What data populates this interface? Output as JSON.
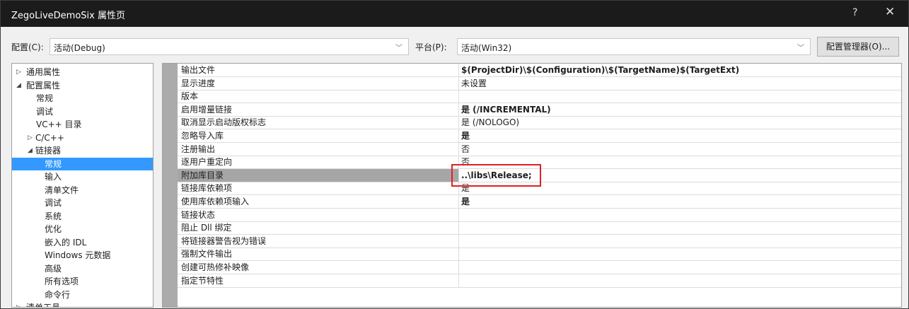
{
  "window": {
    "title": "ZegoLiveDemoSix 属性页",
    "help": "?",
    "close": "✕"
  },
  "config": {
    "config_label": "配置(C):",
    "config_value": "活动(Debug)",
    "platform_label": "平台(P):",
    "platform_value": "活动(Win32)",
    "manager_button": "配置管理器(O)..."
  },
  "tree": {
    "items": [
      {
        "label": "通用属性",
        "arrow": "▷"
      },
      {
        "label": "配置属性",
        "arrow": "◢"
      },
      {
        "label": "常规"
      },
      {
        "label": "调试"
      },
      {
        "label": "VC++ 目录"
      },
      {
        "label": "C/C++",
        "arrow": "▷"
      },
      {
        "label": "链接器",
        "arrow": "◢"
      },
      {
        "label": "常规",
        "selected": true
      },
      {
        "label": "输入"
      },
      {
        "label": "清单文件"
      },
      {
        "label": "调试"
      },
      {
        "label": "系统"
      },
      {
        "label": "优化"
      },
      {
        "label": "嵌入的 IDL"
      },
      {
        "label": "Windows 元数据"
      },
      {
        "label": "高级"
      },
      {
        "label": "所有选项"
      },
      {
        "label": "命令行"
      },
      {
        "label": "清单工具",
        "arrow": "▷"
      }
    ]
  },
  "grid": {
    "rows": [
      {
        "name": "输出文件",
        "value": "$(ProjectDir)\\$(Configuration)\\$(TargetName)$(TargetExt)",
        "bold": true
      },
      {
        "name": "显示进度",
        "value": "未设置"
      },
      {
        "name": "版本",
        "value": ""
      },
      {
        "name": "启用增量链接",
        "value": "是 (/INCREMENTAL)",
        "bold": true
      },
      {
        "name": "取消显示启动版权标志",
        "value": "是 (/NOLOGO)"
      },
      {
        "name": "忽略导入库",
        "value": "是",
        "bold": true
      },
      {
        "name": "注册输出",
        "value": "否"
      },
      {
        "name": "逐用户重定向",
        "value": "否"
      },
      {
        "name": "附加库目录",
        "value": "..\\libs\\Release;",
        "bold": true,
        "selected": true
      },
      {
        "name": "链接库依赖项",
        "value": "是"
      },
      {
        "name": "使用库依赖项输入",
        "value": "是",
        "bold": true
      },
      {
        "name": "链接状态",
        "value": ""
      },
      {
        "name": "阻止 Dll 绑定",
        "value": ""
      },
      {
        "name": "将链接器警告视为错误",
        "value": ""
      },
      {
        "name": "强制文件输出",
        "value": ""
      },
      {
        "name": "创建可热修补映像",
        "value": ""
      },
      {
        "name": "指定节特性",
        "value": ""
      }
    ]
  },
  "colors": {
    "selection": "#3399ff",
    "highlight_box": "#e02020",
    "titlebar": "#1b1b1b"
  }
}
